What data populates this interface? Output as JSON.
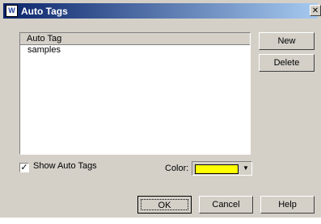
{
  "window": {
    "title": "Auto Tags",
    "app_icon": "W",
    "close_glyph": "✕"
  },
  "list": {
    "header": "Auto Tag",
    "items": [
      "samples"
    ]
  },
  "buttons": {
    "new": "New",
    "delete": "Delete",
    "ok": "OK",
    "cancel": "Cancel",
    "help": "Help"
  },
  "options": {
    "show_auto_tags_label": "Show Auto Tags",
    "show_auto_tags_checked": true,
    "check_glyph": "✓",
    "color_label": "Color:",
    "color_value": "#ffff00",
    "dropdown_glyph": "▼"
  }
}
